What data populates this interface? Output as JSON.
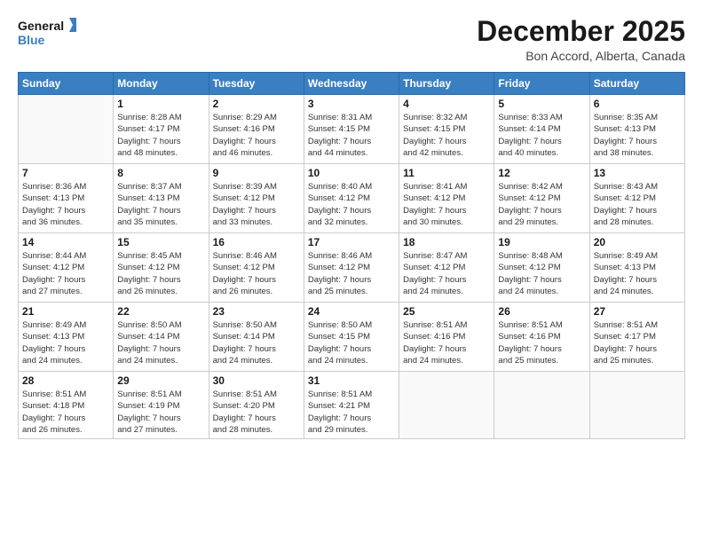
{
  "logo": {
    "line1": "General",
    "line2": "Blue"
  },
  "title": "December 2025",
  "subtitle": "Bon Accord, Alberta, Canada",
  "weekdays": [
    "Sunday",
    "Monday",
    "Tuesday",
    "Wednesday",
    "Thursday",
    "Friday",
    "Saturday"
  ],
  "weeks": [
    [
      {
        "day": "",
        "info": ""
      },
      {
        "day": "1",
        "info": "Sunrise: 8:28 AM\nSunset: 4:17 PM\nDaylight: 7 hours\nand 48 minutes."
      },
      {
        "day": "2",
        "info": "Sunrise: 8:29 AM\nSunset: 4:16 PM\nDaylight: 7 hours\nand 46 minutes."
      },
      {
        "day": "3",
        "info": "Sunrise: 8:31 AM\nSunset: 4:15 PM\nDaylight: 7 hours\nand 44 minutes."
      },
      {
        "day": "4",
        "info": "Sunrise: 8:32 AM\nSunset: 4:15 PM\nDaylight: 7 hours\nand 42 minutes."
      },
      {
        "day": "5",
        "info": "Sunrise: 8:33 AM\nSunset: 4:14 PM\nDaylight: 7 hours\nand 40 minutes."
      },
      {
        "day": "6",
        "info": "Sunrise: 8:35 AM\nSunset: 4:13 PM\nDaylight: 7 hours\nand 38 minutes."
      }
    ],
    [
      {
        "day": "7",
        "info": "Sunrise: 8:36 AM\nSunset: 4:13 PM\nDaylight: 7 hours\nand 36 minutes."
      },
      {
        "day": "8",
        "info": "Sunrise: 8:37 AM\nSunset: 4:13 PM\nDaylight: 7 hours\nand 35 minutes."
      },
      {
        "day": "9",
        "info": "Sunrise: 8:39 AM\nSunset: 4:12 PM\nDaylight: 7 hours\nand 33 minutes."
      },
      {
        "day": "10",
        "info": "Sunrise: 8:40 AM\nSunset: 4:12 PM\nDaylight: 7 hours\nand 32 minutes."
      },
      {
        "day": "11",
        "info": "Sunrise: 8:41 AM\nSunset: 4:12 PM\nDaylight: 7 hours\nand 30 minutes."
      },
      {
        "day": "12",
        "info": "Sunrise: 8:42 AM\nSunset: 4:12 PM\nDaylight: 7 hours\nand 29 minutes."
      },
      {
        "day": "13",
        "info": "Sunrise: 8:43 AM\nSunset: 4:12 PM\nDaylight: 7 hours\nand 28 minutes."
      }
    ],
    [
      {
        "day": "14",
        "info": "Sunrise: 8:44 AM\nSunset: 4:12 PM\nDaylight: 7 hours\nand 27 minutes."
      },
      {
        "day": "15",
        "info": "Sunrise: 8:45 AM\nSunset: 4:12 PM\nDaylight: 7 hours\nand 26 minutes."
      },
      {
        "day": "16",
        "info": "Sunrise: 8:46 AM\nSunset: 4:12 PM\nDaylight: 7 hours\nand 26 minutes."
      },
      {
        "day": "17",
        "info": "Sunrise: 8:46 AM\nSunset: 4:12 PM\nDaylight: 7 hours\nand 25 minutes."
      },
      {
        "day": "18",
        "info": "Sunrise: 8:47 AM\nSunset: 4:12 PM\nDaylight: 7 hours\nand 24 minutes."
      },
      {
        "day": "19",
        "info": "Sunrise: 8:48 AM\nSunset: 4:12 PM\nDaylight: 7 hours\nand 24 minutes."
      },
      {
        "day": "20",
        "info": "Sunrise: 8:49 AM\nSunset: 4:13 PM\nDaylight: 7 hours\nand 24 minutes."
      }
    ],
    [
      {
        "day": "21",
        "info": "Sunrise: 8:49 AM\nSunset: 4:13 PM\nDaylight: 7 hours\nand 24 minutes."
      },
      {
        "day": "22",
        "info": "Sunrise: 8:50 AM\nSunset: 4:14 PM\nDaylight: 7 hours\nand 24 minutes."
      },
      {
        "day": "23",
        "info": "Sunrise: 8:50 AM\nSunset: 4:14 PM\nDaylight: 7 hours\nand 24 minutes."
      },
      {
        "day": "24",
        "info": "Sunrise: 8:50 AM\nSunset: 4:15 PM\nDaylight: 7 hours\nand 24 minutes."
      },
      {
        "day": "25",
        "info": "Sunrise: 8:51 AM\nSunset: 4:16 PM\nDaylight: 7 hours\nand 24 minutes."
      },
      {
        "day": "26",
        "info": "Sunrise: 8:51 AM\nSunset: 4:16 PM\nDaylight: 7 hours\nand 25 minutes."
      },
      {
        "day": "27",
        "info": "Sunrise: 8:51 AM\nSunset: 4:17 PM\nDaylight: 7 hours\nand 25 minutes."
      }
    ],
    [
      {
        "day": "28",
        "info": "Sunrise: 8:51 AM\nSunset: 4:18 PM\nDaylight: 7 hours\nand 26 minutes."
      },
      {
        "day": "29",
        "info": "Sunrise: 8:51 AM\nSunset: 4:19 PM\nDaylight: 7 hours\nand 27 minutes."
      },
      {
        "day": "30",
        "info": "Sunrise: 8:51 AM\nSunset: 4:20 PM\nDaylight: 7 hours\nand 28 minutes."
      },
      {
        "day": "31",
        "info": "Sunrise: 8:51 AM\nSunset: 4:21 PM\nDaylight: 7 hours\nand 29 minutes."
      },
      {
        "day": "",
        "info": ""
      },
      {
        "day": "",
        "info": ""
      },
      {
        "day": "",
        "info": ""
      }
    ]
  ]
}
